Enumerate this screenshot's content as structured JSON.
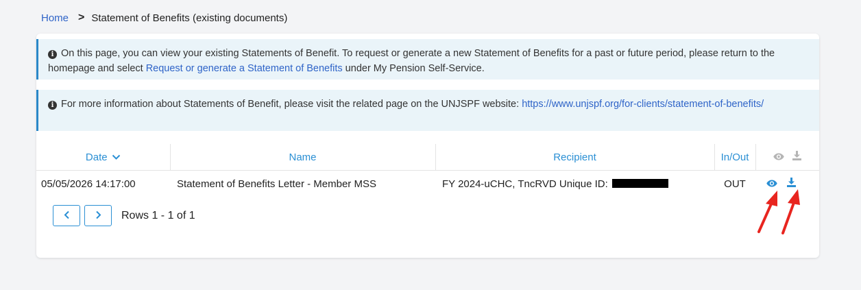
{
  "breadcrumb": {
    "home": "Home",
    "current": "Statement of Benefits (existing documents)"
  },
  "notices": [
    {
      "text_before": "On this page, you can view your existing Statements of Benefit. To request or generate a new Statement of Benefits for a past or future period, please return to the homepage and select ",
      "link": "Request or generate a Statement of Benefits",
      "text_after": " under My Pension Self-Service."
    },
    {
      "text_before": "For more information about Statements of Benefit, please visit the related page on the UNJSPF website: ",
      "link": "https://www.unjspf.org/for-clients/statement-of-benefits/",
      "text_after": ""
    }
  ],
  "table": {
    "headers": {
      "date": "Date",
      "name": "Name",
      "recipient": "Recipient",
      "inout": "In/Out"
    },
    "rows": [
      {
        "date": "05/05/2026 14:17:00",
        "name": "Statement of Benefits Letter - Member MSS",
        "recipient": "FY 2024-uCHC, TncRVD Unique ID:",
        "inout": "OUT"
      }
    ]
  },
  "pager": {
    "rows_label": "Rows 1 - 1 of 1"
  },
  "icons": {
    "sort": "chevron-down-icon",
    "view": "eye-icon",
    "download": "download-icon",
    "prev": "chevron-left-icon",
    "next": "chevron-right-icon",
    "info": "info-icon"
  },
  "colors": {
    "accent": "#2a8fd4",
    "link": "#2f64c8",
    "notice_bg": "#eaf4f9",
    "annotation": "#e8251f"
  }
}
